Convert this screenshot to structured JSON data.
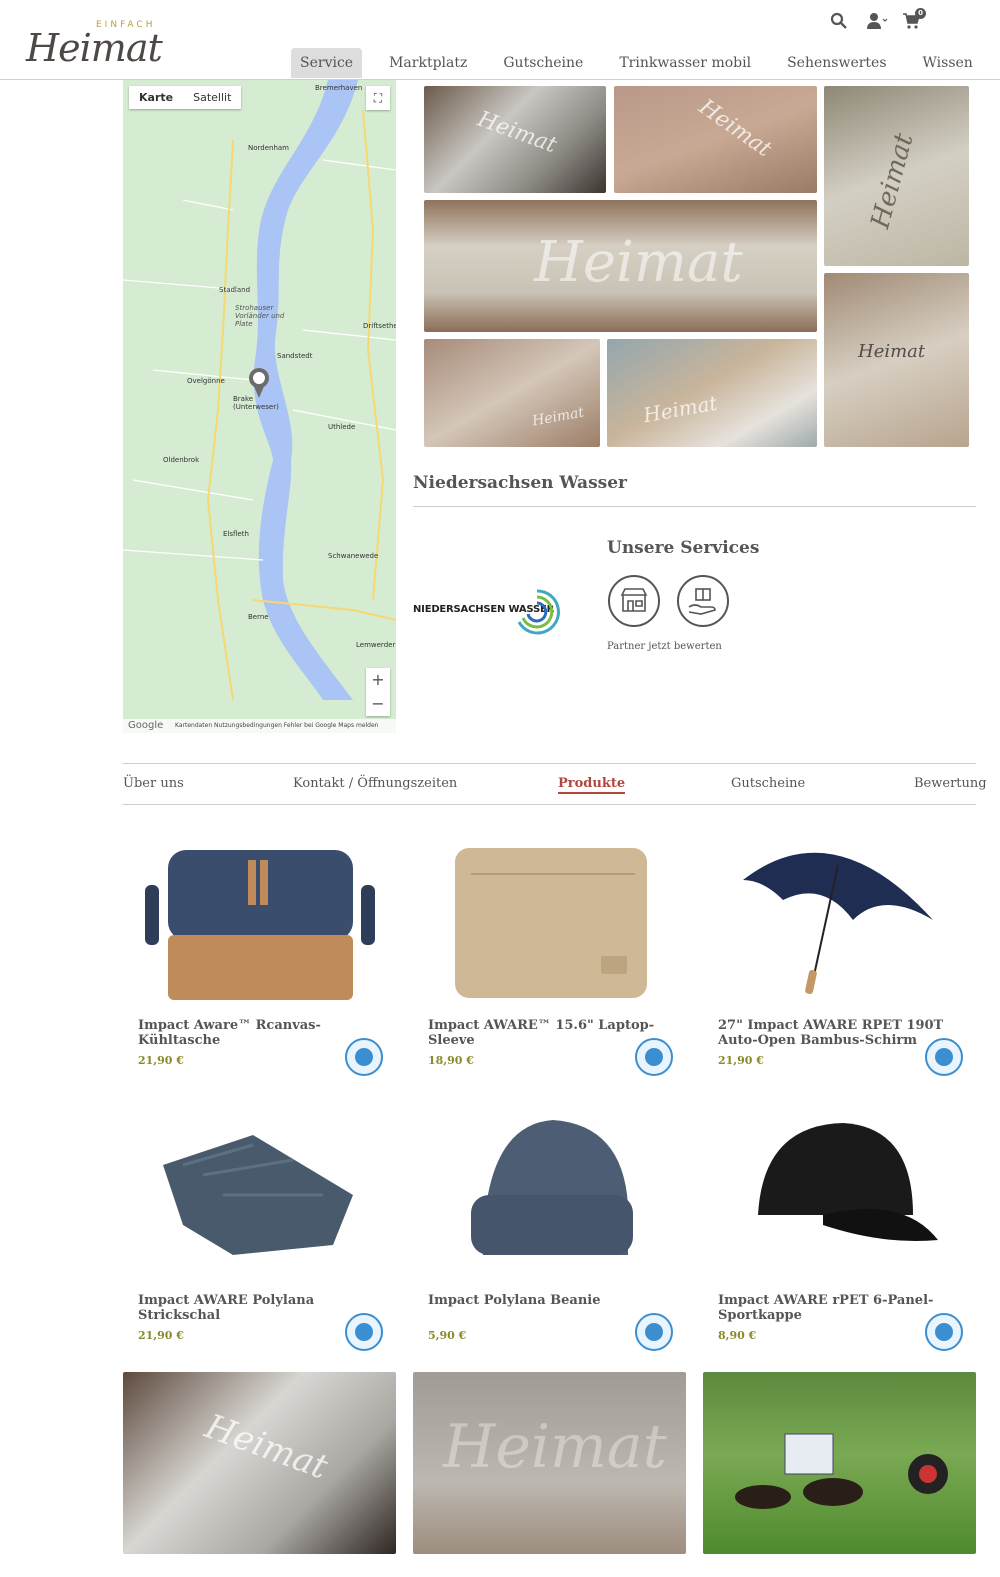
{
  "brand": {
    "small": "EINFACH",
    "big": "Heimat"
  },
  "header": {
    "cart_count": "0"
  },
  "nav": [
    "Service",
    "Marktplatz",
    "Gutscheine",
    "Trinkwasser mobil",
    "Sehenswertes",
    "Wissen"
  ],
  "map": {
    "tab_map": "Karte",
    "tab_satellite": "Satellit",
    "zoom_in": "+",
    "zoom_out": "−",
    "google": "Google",
    "footer": "Kartendaten   Nutzungsbedingungen   Fehler bei Google Maps melden",
    "places": [
      "Bremerhaven",
      "Nordenham",
      "Stadland",
      "Strohauser Vorländer und Plate",
      "Sandstedt",
      "Ovelgönne",
      "Brake (Unterweser)",
      "Uthlede",
      "Elsfleth",
      "Schwanewede",
      "Berne",
      "Lemwerder",
      "Driftsethe",
      "Oldenbrok"
    ]
  },
  "company": {
    "title": "Niedersachsen Wasser",
    "logo_text": "NIEDERSACHSEN WASSER"
  },
  "services": {
    "heading": "Unsere Services",
    "rate_link": "Partner jetzt bewerten"
  },
  "tabs": [
    "Über uns",
    "Kontakt / Öffnungszeiten",
    "Produkte",
    "Gutscheine",
    "Bewertung"
  ],
  "products": [
    {
      "name": "Impact Aware™ Rcanvas-Kühltasche",
      "price": "21,90 €"
    },
    {
      "name": "Impact AWARE™ 15.6\" Laptop-Sleeve",
      "price": "18,90 €"
    },
    {
      "name": "27\" Impact AWARE RPET 190T Auto-Open Bambus-Schirm",
      "price": "21,90 €"
    },
    {
      "name": "Impact AWARE Polylana Strickschal",
      "price": "21,90 €"
    },
    {
      "name": "Impact Polylana Beanie",
      "price": "5,90 €"
    },
    {
      "name": "Impact AWARE rPET 6-Panel-Sportkappe",
      "price": "8,90 €"
    }
  ],
  "photo_watermark": "Heimat",
  "colors": {
    "accent": "#b04840",
    "price": "#8a8a2a",
    "badge": "#3b8fd1",
    "nav_active": "#dddddd"
  }
}
